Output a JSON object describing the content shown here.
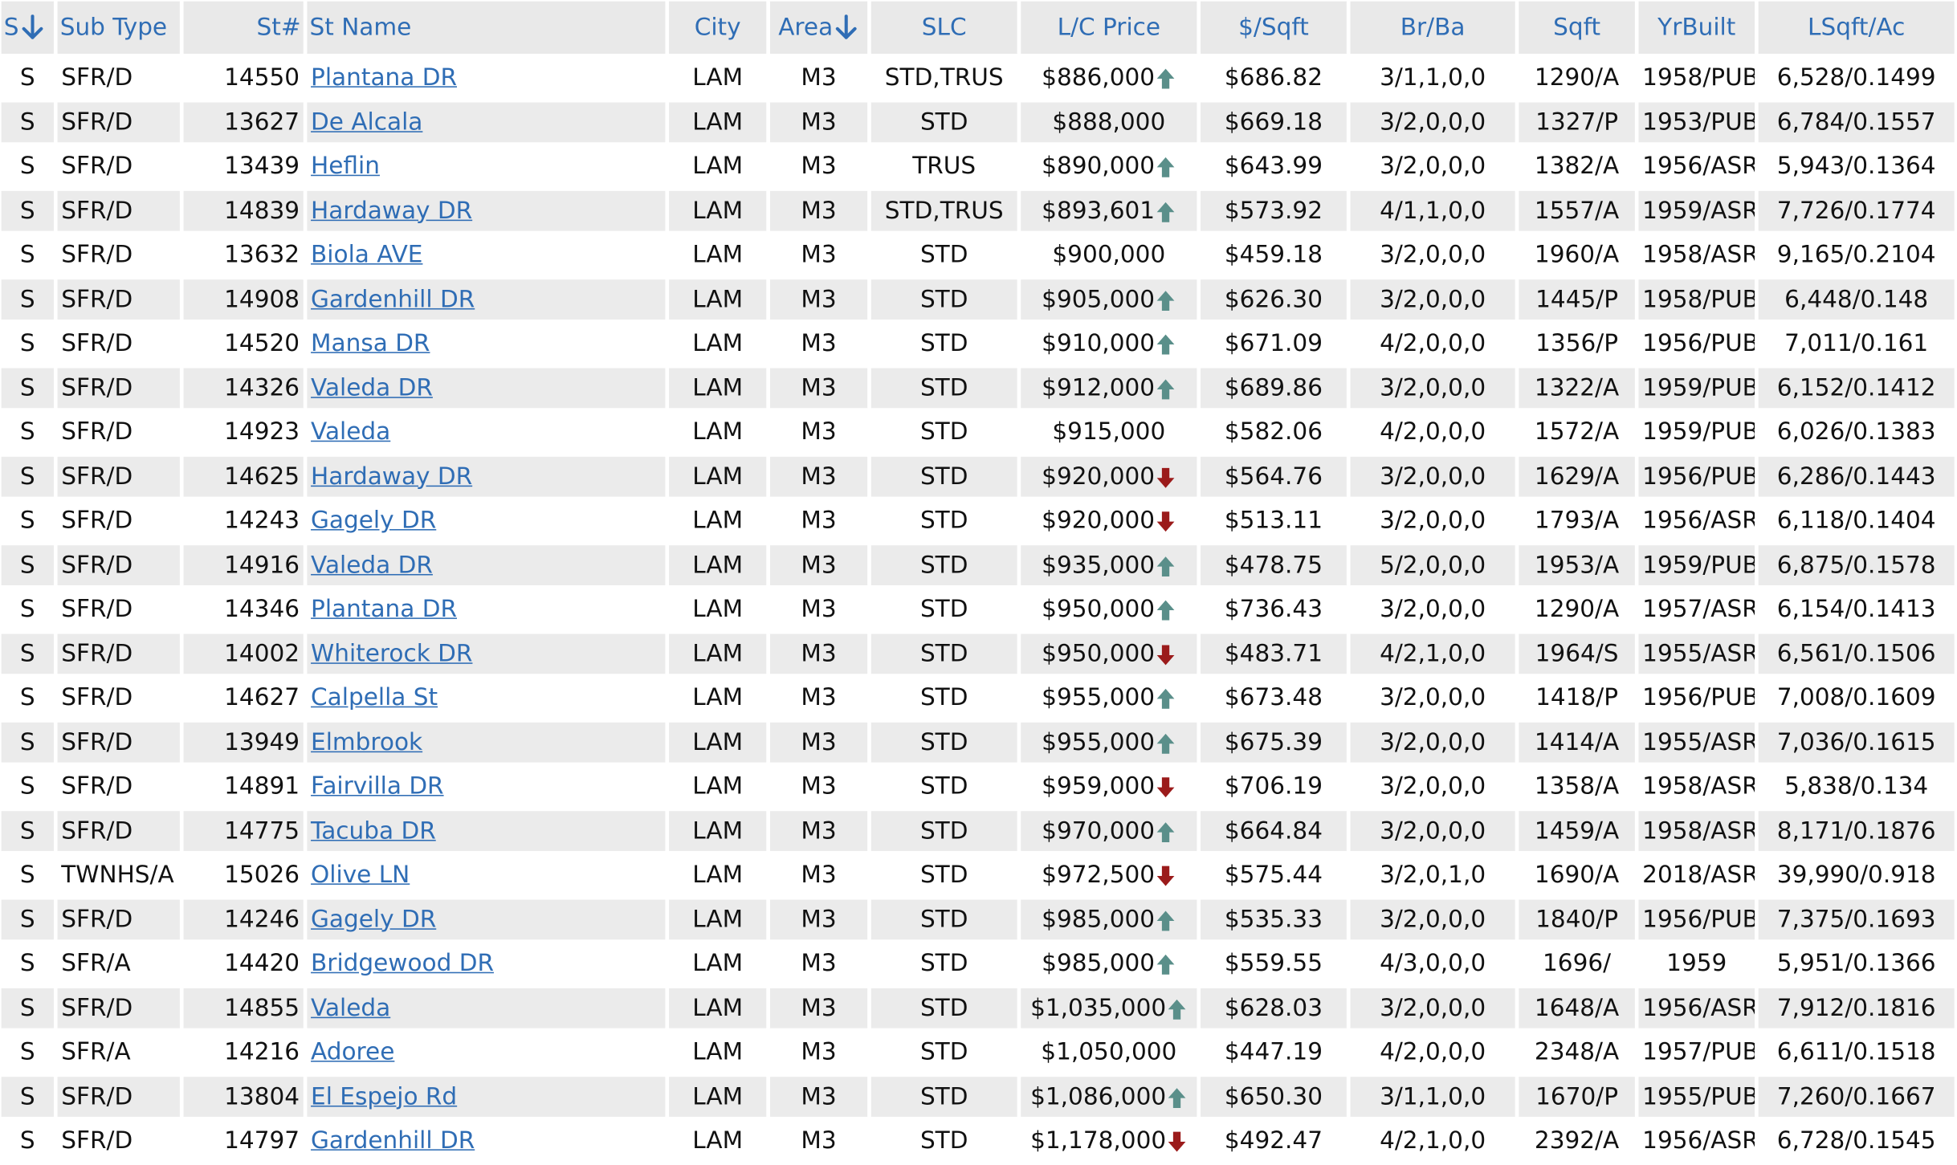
{
  "headers": {
    "status": "S",
    "sub_type": "Sub Type",
    "st_num": "St#",
    "st_name": "St Name",
    "city": "City",
    "area": "Area",
    "slc": "SLC",
    "price": "L/C Price",
    "ppsf": "$/Sqft",
    "brba": "Br/Ba",
    "sqft": "Sqft",
    "yrbuilt": "YrBuilt",
    "lsqft": "LSqft/Ac"
  },
  "colors": {
    "link": "#2f6db5",
    "up_arrow": "#5a8f8a",
    "down_arrow": "#9b1b1b",
    "row_alt": "#ebebeb",
    "header_bg": "#e9e9e9"
  },
  "rows": [
    {
      "status": "S",
      "sub_type": "SFR/D",
      "st_num": "14550",
      "st_name": "Plantana DR",
      "city": "LAM",
      "area": "M3",
      "slc": "STD,TRUS",
      "price": "$886,000",
      "trend": "up",
      "ppsf": "$686.82",
      "brba": "3/1,1,0,0",
      "sqft": "1290/A",
      "yrbuilt": "1958/PUB",
      "lsqft": "6,528/0.1499"
    },
    {
      "status": "S",
      "sub_type": "SFR/D",
      "st_num": "13627",
      "st_name": "De Alcala",
      "city": "LAM",
      "area": "M3",
      "slc": "STD",
      "price": "$888,000",
      "trend": "none",
      "ppsf": "$669.18",
      "brba": "3/2,0,0,0",
      "sqft": "1327/P",
      "yrbuilt": "1953/PUB",
      "lsqft": "6,784/0.1557"
    },
    {
      "status": "S",
      "sub_type": "SFR/D",
      "st_num": "13439",
      "st_name": "Heflin",
      "city": "LAM",
      "area": "M3",
      "slc": "TRUS",
      "price": "$890,000",
      "trend": "up",
      "ppsf": "$643.99",
      "brba": "3/2,0,0,0",
      "sqft": "1382/A",
      "yrbuilt": "1956/ASR",
      "lsqft": "5,943/0.1364"
    },
    {
      "status": "S",
      "sub_type": "SFR/D",
      "st_num": "14839",
      "st_name": "Hardaway DR",
      "city": "LAM",
      "area": "M3",
      "slc": "STD,TRUS",
      "price": "$893,601",
      "trend": "up",
      "ppsf": "$573.92",
      "brba": "4/1,1,0,0",
      "sqft": "1557/A",
      "yrbuilt": "1959/ASR",
      "lsqft": "7,726/0.1774"
    },
    {
      "status": "S",
      "sub_type": "SFR/D",
      "st_num": "13632",
      "st_name": "Biola AVE",
      "city": "LAM",
      "area": "M3",
      "slc": "STD",
      "price": "$900,000",
      "trend": "none",
      "ppsf": "$459.18",
      "brba": "3/2,0,0,0",
      "sqft": "1960/A",
      "yrbuilt": "1958/ASR",
      "lsqft": "9,165/0.2104"
    },
    {
      "status": "S",
      "sub_type": "SFR/D",
      "st_num": "14908",
      "st_name": "Gardenhill DR",
      "city": "LAM",
      "area": "M3",
      "slc": "STD",
      "price": "$905,000",
      "trend": "up",
      "ppsf": "$626.30",
      "brba": "3/2,0,0,0",
      "sqft": "1445/P",
      "yrbuilt": "1958/PUB",
      "lsqft": "6,448/0.148"
    },
    {
      "status": "S",
      "sub_type": "SFR/D",
      "st_num": "14520",
      "st_name": "Mansa DR",
      "city": "LAM",
      "area": "M3",
      "slc": "STD",
      "price": "$910,000",
      "trend": "up",
      "ppsf": "$671.09",
      "brba": "4/2,0,0,0",
      "sqft": "1356/P",
      "yrbuilt": "1956/PUB",
      "lsqft": "7,011/0.161"
    },
    {
      "status": "S",
      "sub_type": "SFR/D",
      "st_num": "14326",
      "st_name": "Valeda DR",
      "city": "LAM",
      "area": "M3",
      "slc": "STD",
      "price": "$912,000",
      "trend": "up",
      "ppsf": "$689.86",
      "brba": "3/2,0,0,0",
      "sqft": "1322/A",
      "yrbuilt": "1959/PUB",
      "lsqft": "6,152/0.1412"
    },
    {
      "status": "S",
      "sub_type": "SFR/D",
      "st_num": "14923",
      "st_name": "Valeda",
      "city": "LAM",
      "area": "M3",
      "slc": "STD",
      "price": "$915,000",
      "trend": "none",
      "ppsf": "$582.06",
      "brba": "4/2,0,0,0",
      "sqft": "1572/A",
      "yrbuilt": "1959/PUB",
      "lsqft": "6,026/0.1383"
    },
    {
      "status": "S",
      "sub_type": "SFR/D",
      "st_num": "14625",
      "st_name": "Hardaway DR",
      "city": "LAM",
      "area": "M3",
      "slc": "STD",
      "price": "$920,000",
      "trend": "down",
      "ppsf": "$564.76",
      "brba": "3/2,0,0,0",
      "sqft": "1629/A",
      "yrbuilt": "1956/PUB",
      "lsqft": "6,286/0.1443"
    },
    {
      "status": "S",
      "sub_type": "SFR/D",
      "st_num": "14243",
      "st_name": "Gagely DR",
      "city": "LAM",
      "area": "M3",
      "slc": "STD",
      "price": "$920,000",
      "trend": "down",
      "ppsf": "$513.11",
      "brba": "3/2,0,0,0",
      "sqft": "1793/A",
      "yrbuilt": "1956/ASR",
      "lsqft": "6,118/0.1404"
    },
    {
      "status": "S",
      "sub_type": "SFR/D",
      "st_num": "14916",
      "st_name": "Valeda DR",
      "city": "LAM",
      "area": "M3",
      "slc": "STD",
      "price": "$935,000",
      "trend": "up",
      "ppsf": "$478.75",
      "brba": "5/2,0,0,0",
      "sqft": "1953/A",
      "yrbuilt": "1959/PUB",
      "lsqft": "6,875/0.1578"
    },
    {
      "status": "S",
      "sub_type": "SFR/D",
      "st_num": "14346",
      "st_name": "Plantana DR",
      "city": "LAM",
      "area": "M3",
      "slc": "STD",
      "price": "$950,000",
      "trend": "up",
      "ppsf": "$736.43",
      "brba": "3/2,0,0,0",
      "sqft": "1290/A",
      "yrbuilt": "1957/ASR",
      "lsqft": "6,154/0.1413"
    },
    {
      "status": "S",
      "sub_type": "SFR/D",
      "st_num": "14002",
      "st_name": "Whiterock DR",
      "city": "LAM",
      "area": "M3",
      "slc": "STD",
      "price": "$950,000",
      "trend": "down",
      "ppsf": "$483.71",
      "brba": "4/2,1,0,0",
      "sqft": "1964/S",
      "yrbuilt": "1955/ASR",
      "lsqft": "6,561/0.1506"
    },
    {
      "status": "S",
      "sub_type": "SFR/D",
      "st_num": "14627",
      "st_name": "Calpella St",
      "city": "LAM",
      "area": "M3",
      "slc": "STD",
      "price": "$955,000",
      "trend": "up",
      "ppsf": "$673.48",
      "brba": "3/2,0,0,0",
      "sqft": "1418/P",
      "yrbuilt": "1956/PUB",
      "lsqft": "7,008/0.1609"
    },
    {
      "status": "S",
      "sub_type": "SFR/D",
      "st_num": "13949",
      "st_name": "Elmbrook",
      "city": "LAM",
      "area": "M3",
      "slc": "STD",
      "price": "$955,000",
      "trend": "up",
      "ppsf": "$675.39",
      "brba": "3/2,0,0,0",
      "sqft": "1414/A",
      "yrbuilt": "1955/ASR",
      "lsqft": "7,036/0.1615"
    },
    {
      "status": "S",
      "sub_type": "SFR/D",
      "st_num": "14891",
      "st_name": "Fairvilla DR",
      "city": "LAM",
      "area": "M3",
      "slc": "STD",
      "price": "$959,000",
      "trend": "down",
      "ppsf": "$706.19",
      "brba": "3/2,0,0,0",
      "sqft": "1358/A",
      "yrbuilt": "1958/ASR",
      "lsqft": "5,838/0.134"
    },
    {
      "status": "S",
      "sub_type": "SFR/D",
      "st_num": "14775",
      "st_name": "Tacuba DR",
      "city": "LAM",
      "area": "M3",
      "slc": "STD",
      "price": "$970,000",
      "trend": "up",
      "ppsf": "$664.84",
      "brba": "3/2,0,0,0",
      "sqft": "1459/A",
      "yrbuilt": "1958/ASR",
      "lsqft": "8,171/0.1876"
    },
    {
      "status": "S",
      "sub_type": "TWNHS/A",
      "st_num": "15026",
      "st_name": "Olive LN",
      "city": "LAM",
      "area": "M3",
      "slc": "STD",
      "price": "$972,500",
      "trend": "down",
      "ppsf": "$575.44",
      "brba": "3/2,0,1,0",
      "sqft": "1690/A",
      "yrbuilt": "2018/ASR",
      "lsqft": "39,990/0.918"
    },
    {
      "status": "S",
      "sub_type": "SFR/D",
      "st_num": "14246",
      "st_name": "Gagely DR",
      "city": "LAM",
      "area": "M3",
      "slc": "STD",
      "price": "$985,000",
      "trend": "up",
      "ppsf": "$535.33",
      "brba": "3/2,0,0,0",
      "sqft": "1840/P",
      "yrbuilt": "1956/PUB",
      "lsqft": "7,375/0.1693"
    },
    {
      "status": "S",
      "sub_type": "SFR/A",
      "st_num": "14420",
      "st_name": "Bridgewood DR",
      "city": "LAM",
      "area": "M3",
      "slc": "STD",
      "price": "$985,000",
      "trend": "up",
      "ppsf": "$559.55",
      "brba": "4/3,0,0,0",
      "sqft": "1696/",
      "yrbuilt": "1959",
      "lsqft": "5,951/0.1366"
    },
    {
      "status": "S",
      "sub_type": "SFR/D",
      "st_num": "14855",
      "st_name": "Valeda",
      "city": "LAM",
      "area": "M3",
      "slc": "STD",
      "price": "$1,035,000",
      "trend": "up",
      "ppsf": "$628.03",
      "brba": "3/2,0,0,0",
      "sqft": "1648/A",
      "yrbuilt": "1956/ASR",
      "lsqft": "7,912/0.1816"
    },
    {
      "status": "S",
      "sub_type": "SFR/A",
      "st_num": "14216",
      "st_name": "Adoree",
      "city": "LAM",
      "area": "M3",
      "slc": "STD",
      "price": "$1,050,000",
      "trend": "none",
      "ppsf": "$447.19",
      "brba": "4/2,0,0,0",
      "sqft": "2348/A",
      "yrbuilt": "1957/PUB",
      "lsqft": "6,611/0.1518"
    },
    {
      "status": "S",
      "sub_type": "SFR/D",
      "st_num": "13804",
      "st_name": "El Espejo Rd",
      "city": "LAM",
      "area": "M3",
      "slc": "STD",
      "price": "$1,086,000",
      "trend": "up",
      "ppsf": "$650.30",
      "brba": "3/1,1,0,0",
      "sqft": "1670/P",
      "yrbuilt": "1955/PUB",
      "lsqft": "7,260/0.1667"
    },
    {
      "status": "S",
      "sub_type": "SFR/D",
      "st_num": "14797",
      "st_name": "Gardenhill DR",
      "city": "LAM",
      "area": "M3",
      "slc": "STD",
      "price": "$1,178,000",
      "trend": "down",
      "ppsf": "$492.47",
      "brba": "4/2,1,0,0",
      "sqft": "2392/A",
      "yrbuilt": "1956/ASR",
      "lsqft": "6,728/0.1545"
    }
  ]
}
